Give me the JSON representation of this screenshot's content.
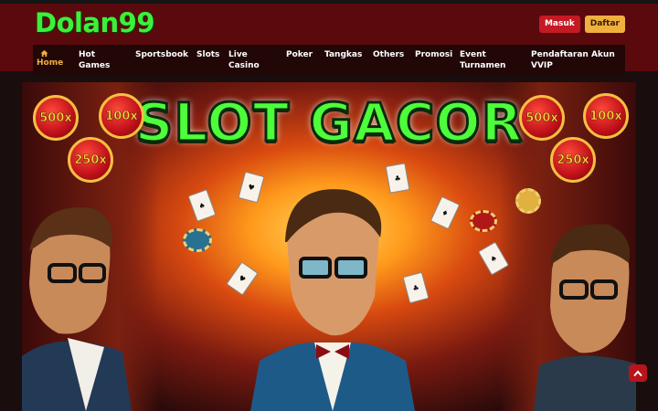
{
  "header": {
    "logo_text": "Dolan99",
    "login_label": "Masuk",
    "register_label": "Daftar"
  },
  "nav": {
    "items": [
      {
        "label": "Home",
        "icon": "home-icon",
        "active": true
      },
      {
        "label": "Hot Games"
      },
      {
        "label": "Sportsbook"
      },
      {
        "label": "Slots"
      },
      {
        "label": "Live Casino"
      },
      {
        "label": "Poker"
      },
      {
        "label": "Tangkas"
      },
      {
        "label": "Others"
      },
      {
        "label": "Promosi"
      },
      {
        "label": "Event Turnamen"
      },
      {
        "label": "Pendaftaran Akun VVIP"
      }
    ]
  },
  "hero": {
    "title": "SLOT GACOR",
    "badges": [
      "500x",
      "100x",
      "250x",
      "500x",
      "100x",
      "250x"
    ]
  },
  "colors": {
    "header_bg": "#5a0a0d",
    "logo": "#3cf03a",
    "login": "#c51a23",
    "register": "#f0b040",
    "nav_active": "#f0b040"
  },
  "scroll_top_icon": "chevron-up-icon"
}
